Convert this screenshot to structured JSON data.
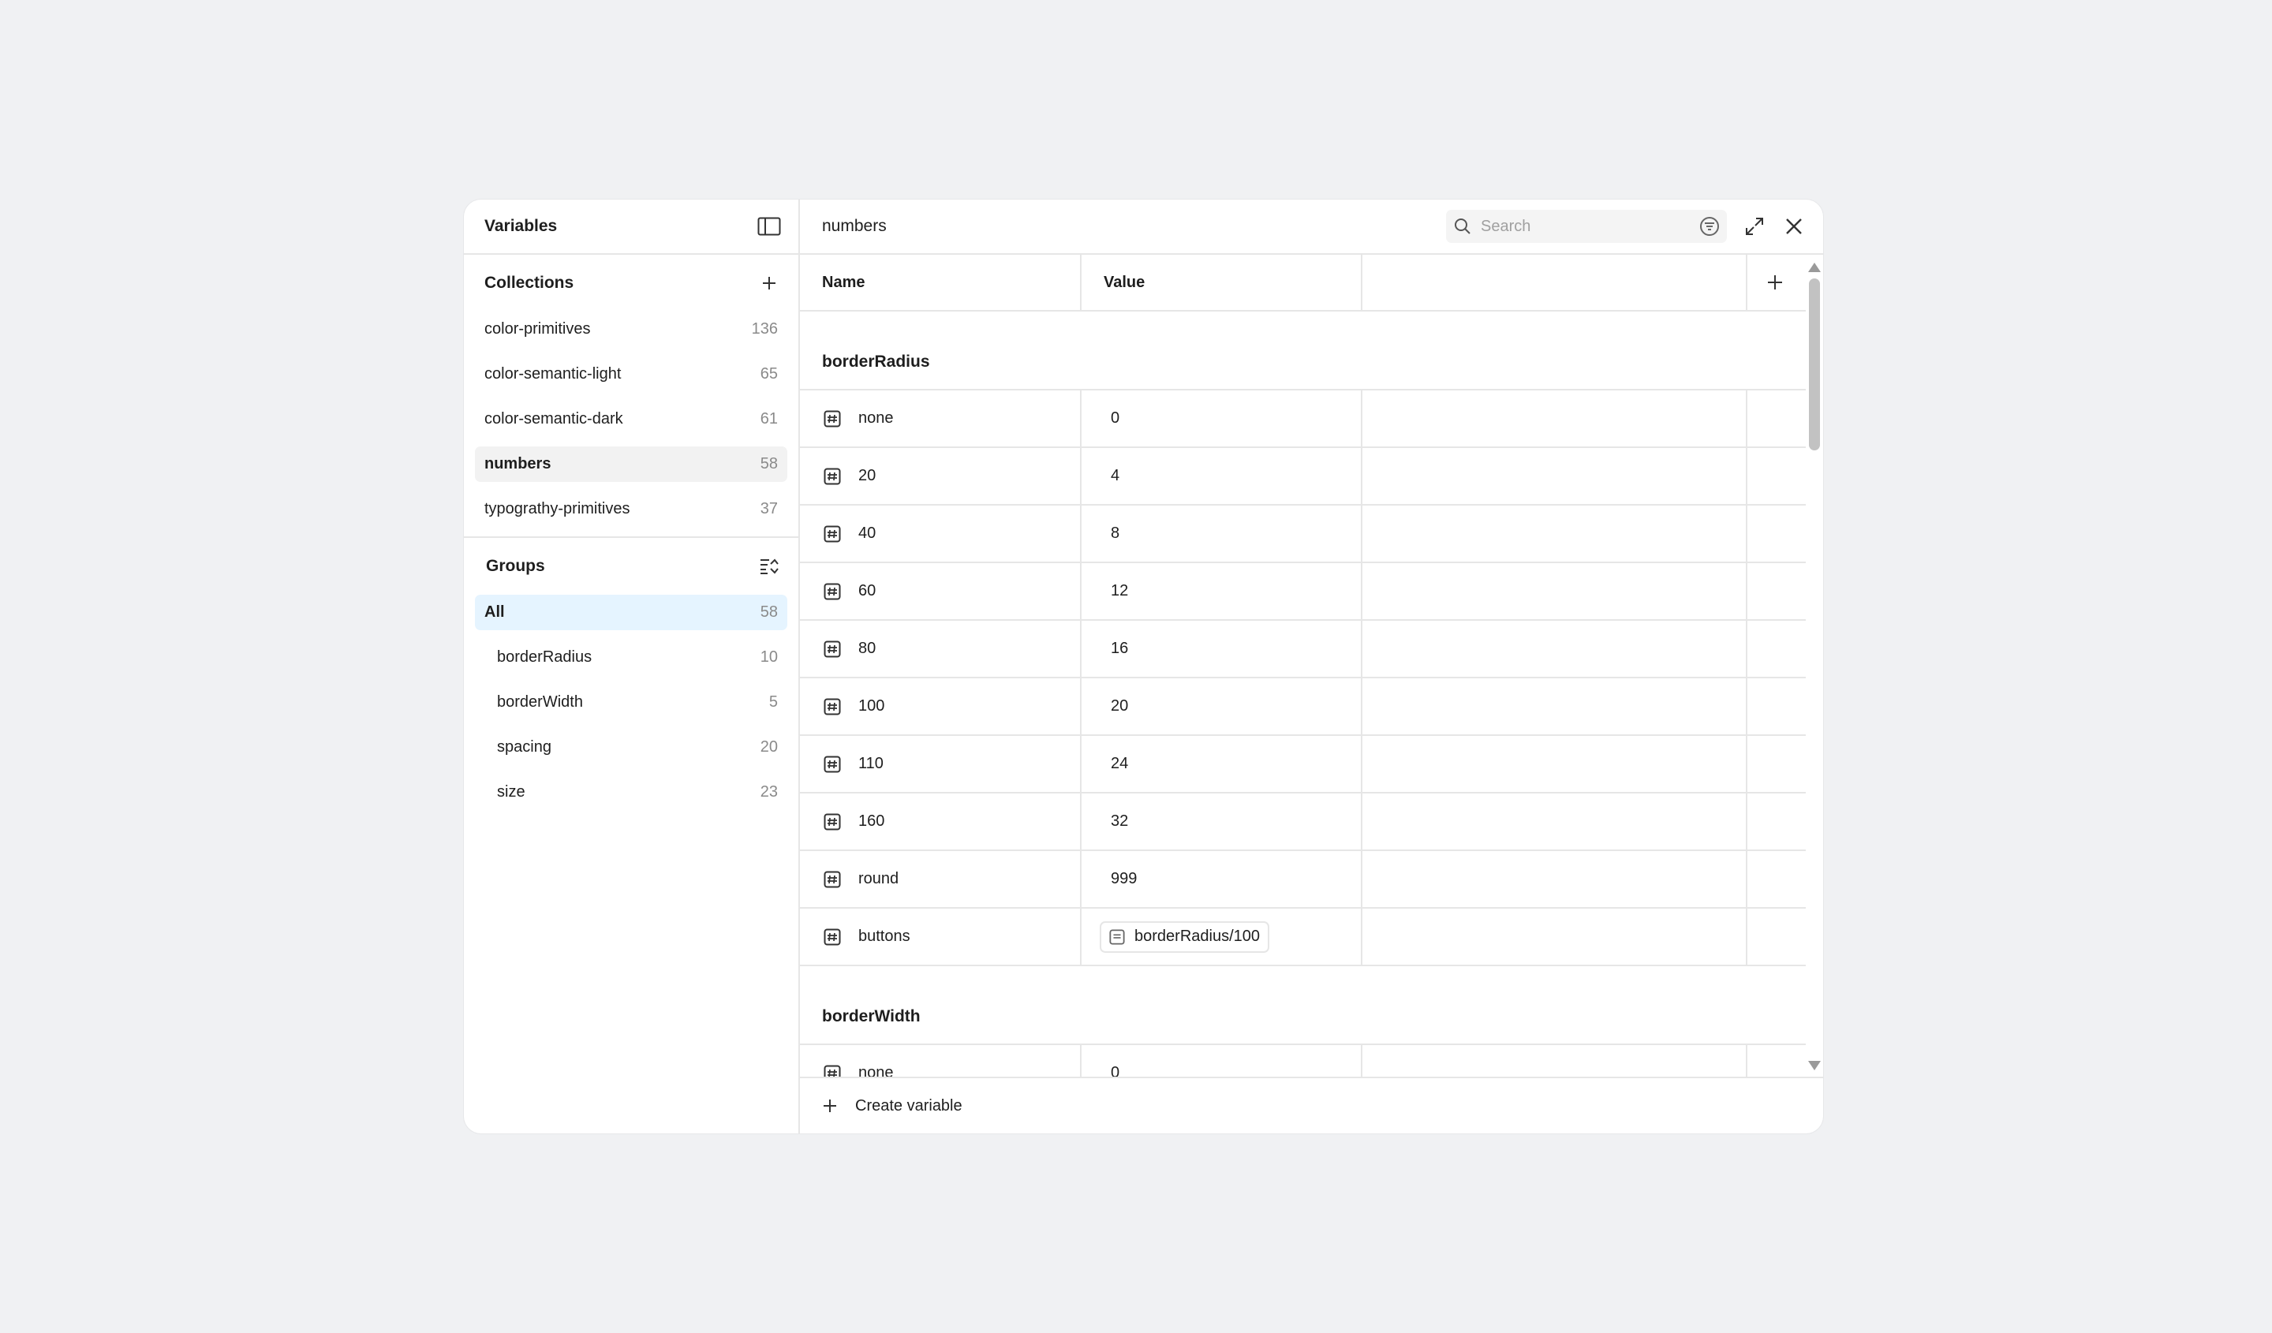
{
  "left_panel": {
    "title": "Variables",
    "collections": {
      "title": "Collections",
      "items": [
        {
          "label": "color-primitives",
          "count": "136"
        },
        {
          "label": "color-semantic-light",
          "count": "65"
        },
        {
          "label": "color-semantic-dark",
          "count": "61"
        },
        {
          "label": "numbers",
          "count": "58"
        },
        {
          "label": "typograthy-primitives",
          "count": "37"
        }
      ]
    },
    "groups": {
      "title": "Groups",
      "items": [
        {
          "label": "All",
          "count": "58"
        },
        {
          "label": "borderRadius",
          "count": "10"
        },
        {
          "label": "borderWidth",
          "count": "5"
        },
        {
          "label": "spacing",
          "count": "20"
        },
        {
          "label": "size",
          "count": "23"
        }
      ]
    }
  },
  "right_panel": {
    "breadcrumb": "numbers",
    "search": {
      "placeholder": "Search",
      "value": ""
    },
    "columns": {
      "name": "Name",
      "value": "Value"
    },
    "groups": [
      {
        "title": "borderRadius",
        "rows": [
          {
            "name": "none",
            "value": "0"
          },
          {
            "name": "20",
            "value": "4"
          },
          {
            "name": "40",
            "value": "8"
          },
          {
            "name": "60",
            "value": "12"
          },
          {
            "name": "80",
            "value": "16"
          },
          {
            "name": "100",
            "value": "20"
          },
          {
            "name": "110",
            "value": "24"
          },
          {
            "name": "160",
            "value": "32"
          },
          {
            "name": "round",
            "value": "999"
          },
          {
            "name": "buttons",
            "alias": "borderRadius/100"
          }
        ]
      },
      {
        "title": "borderWidth",
        "rows": [
          {
            "name": "none",
            "value": "0"
          }
        ]
      }
    ],
    "footer": {
      "create_label": "Create variable"
    }
  },
  "icons": {
    "sidebar_toggle": "sidebar-toggle-icon",
    "add": "plus-icon",
    "group_filter": "list-filter-icon",
    "search": "search-icon",
    "filter": "filter-icon",
    "expand": "expand-icon",
    "close": "close-icon",
    "variable": "number-variable-icon"
  }
}
